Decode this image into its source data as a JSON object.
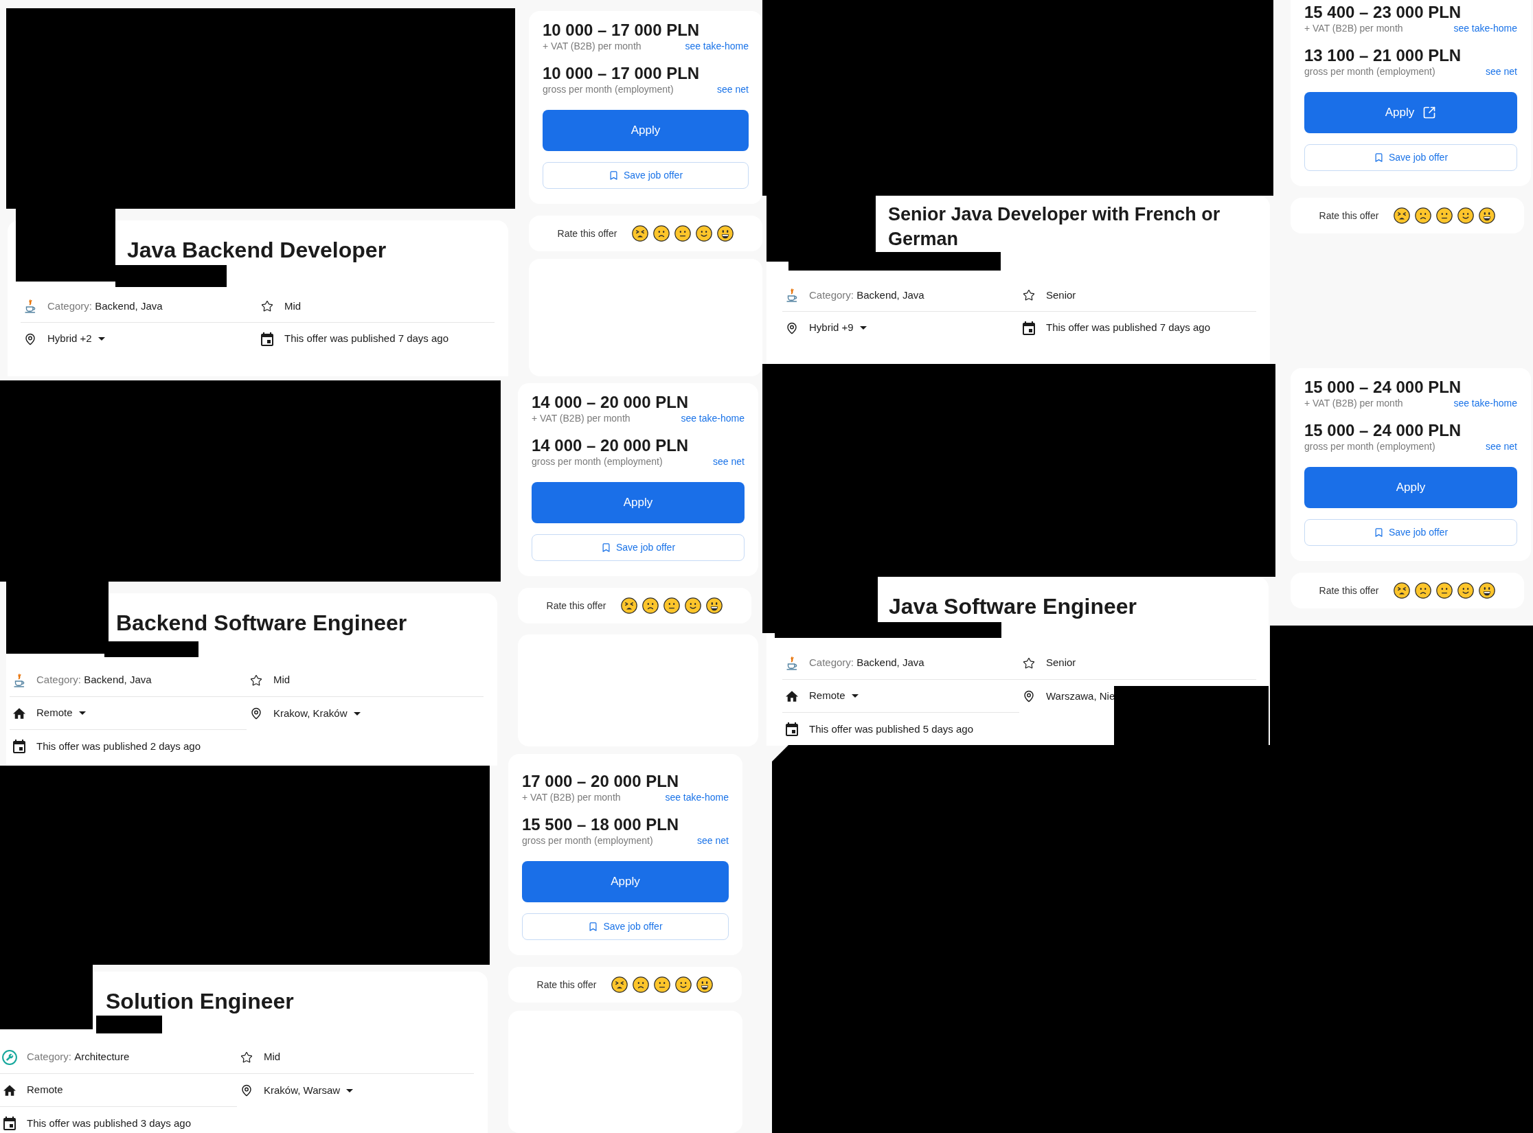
{
  "offers": [
    {
      "title": "Java Backend Developer",
      "details": [
        {
          "kind": "category",
          "label": "Category:",
          "value": "Backend, Java",
          "dropdown": false
        },
        {
          "kind": "level",
          "value": "Mid",
          "dropdown": false
        },
        {
          "kind": "location",
          "value": "Hybrid +2",
          "dropdown": true
        },
        {
          "kind": "published",
          "value": "This offer was published 7 days ago",
          "dropdown": false
        }
      ],
      "salaries": [
        {
          "amount": "10 000 – 17 000 PLN",
          "note": "+ VAT (B2B) per month",
          "link": "see take-home"
        },
        {
          "amount": "10 000 – 17 000 PLN",
          "note": "gross per month (employment)",
          "link": "see net"
        }
      ],
      "apply": {
        "label": "Apply",
        "external": false
      },
      "save": {
        "label": "Save job offer"
      },
      "rating": {
        "label": "Rate this offer"
      }
    },
    {
      "title": "Senior Java Developer with French or German",
      "details": [
        {
          "kind": "category",
          "label": "Category:",
          "value": "Backend, Java",
          "dropdown": false
        },
        {
          "kind": "level",
          "value": "Senior",
          "dropdown": false
        },
        {
          "kind": "location",
          "value": "Hybrid +9",
          "dropdown": true
        },
        {
          "kind": "published",
          "value": "This offer was published 7 days ago",
          "dropdown": false
        }
      ],
      "salaries": [
        {
          "amount": "15 400 – 23 000 PLN",
          "note": "+ VAT (B2B) per month",
          "link": "see take-home"
        },
        {
          "amount": "13 100 – 21 000 PLN",
          "note": "gross per month (employment)",
          "link": "see net"
        }
      ],
      "apply": {
        "label": "Apply",
        "external": true
      },
      "save": {
        "label": "Save job offer"
      },
      "rating": {
        "label": "Rate this offer"
      }
    },
    {
      "title": "Backend Software Engineer",
      "details": [
        {
          "kind": "category",
          "label": "Category:",
          "value": "Backend, Java",
          "dropdown": false
        },
        {
          "kind": "level",
          "value": "Mid",
          "dropdown": false
        },
        {
          "kind": "workmode",
          "value": "Remote",
          "dropdown": true
        },
        {
          "kind": "location",
          "value": "Krakow, Kraków",
          "dropdown": true
        },
        {
          "kind": "published",
          "value": "This offer was published 2 days ago",
          "dropdown": false
        }
      ],
      "salaries": [
        {
          "amount": "14 000 – 20 000 PLN",
          "note": "+ VAT (B2B) per month",
          "link": "see take-home"
        },
        {
          "amount": "14 000 – 20 000 PLN",
          "note": "gross per month (employment)",
          "link": "see net"
        }
      ],
      "apply": {
        "label": "Apply",
        "external": false
      },
      "save": {
        "label": "Save job offer"
      },
      "rating": {
        "label": "Rate this offer"
      }
    },
    {
      "title": "Java Software Engineer",
      "details": [
        {
          "kind": "category",
          "label": "Category:",
          "value": "Backend, Java",
          "dropdown": false
        },
        {
          "kind": "level",
          "value": "Senior",
          "dropdown": false
        },
        {
          "kind": "workmode",
          "value": "Remote",
          "dropdown": true
        },
        {
          "kind": "location",
          "value": "Warszawa, Nie",
          "dropdown": false
        },
        {
          "kind": "published",
          "value": "This offer was published 5 days ago",
          "dropdown": false
        }
      ],
      "salaries": [
        {
          "amount": "15 000 – 24 000 PLN",
          "note": "+ VAT (B2B) per month",
          "link": "see take-home"
        },
        {
          "amount": "15 000 – 24 000 PLN",
          "note": "gross per month (employment)",
          "link": "see net"
        }
      ],
      "apply": {
        "label": "Apply",
        "external": false
      },
      "save": {
        "label": "Save job offer"
      },
      "rating": {
        "label": "Rate this offer"
      }
    },
    {
      "title": "Solution Engineer",
      "details": [
        {
          "kind": "rolecategory",
          "label": "Category:",
          "value": "Architecture",
          "dropdown": false
        },
        {
          "kind": "level",
          "value": "Mid",
          "dropdown": false
        },
        {
          "kind": "workmode",
          "value": "Remote",
          "dropdown": false
        },
        {
          "kind": "location",
          "value": "Kraków, Warsaw",
          "dropdown": true
        },
        {
          "kind": "published",
          "value": "This offer was published 3 days ago",
          "dropdown": false
        }
      ],
      "salaries": [
        {
          "amount": "17 000 – 20 000 PLN",
          "note": "+ VAT (B2B) per month",
          "link": "see take-home"
        },
        {
          "amount": "15 500 – 18 000 PLN",
          "note": "gross per month (employment)",
          "link": "see net"
        }
      ],
      "apply": {
        "label": "Apply",
        "external": false
      },
      "save": {
        "label": "Save job offer"
      },
      "rating": {
        "label": "Rate this offer"
      }
    }
  ]
}
